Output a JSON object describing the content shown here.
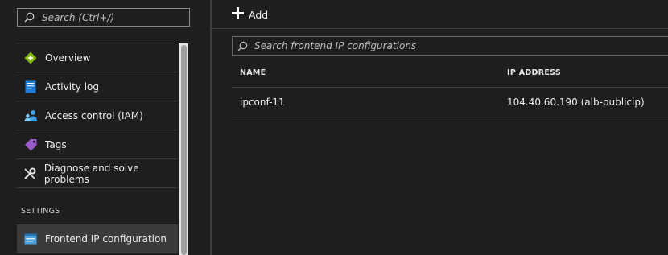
{
  "sidebar": {
    "search_placeholder": "Search (Ctrl+/)",
    "items": [
      {
        "label": "Overview",
        "icon": "overview-icon"
      },
      {
        "label": "Activity log",
        "icon": "activity-log-icon"
      },
      {
        "label": "Access control (IAM)",
        "icon": "access-control-icon"
      },
      {
        "label": "Tags",
        "icon": "tag-icon"
      },
      {
        "label": "Diagnose and solve problems",
        "icon": "wrench-icon"
      }
    ],
    "section_label": "SETTINGS",
    "selected_item": {
      "label": "Frontend IP configuration",
      "icon": "frontend-ip-icon"
    }
  },
  "toolbar": {
    "add_label": "Add"
  },
  "filter": {
    "placeholder": "Search frontend IP configurations"
  },
  "table": {
    "columns": [
      "NAME",
      "IP ADDRESS"
    ],
    "rows": [
      {
        "name": "ipconf-11",
        "ip": "104.40.60.190 (alb-publicip)"
      }
    ]
  },
  "colors": {
    "background": "#1e1e1e",
    "selected": "#3b3b3b",
    "overview_green": "#7fba00",
    "activity_blue": "#1e90ff",
    "tag_purple": "#8a4fbf"
  }
}
